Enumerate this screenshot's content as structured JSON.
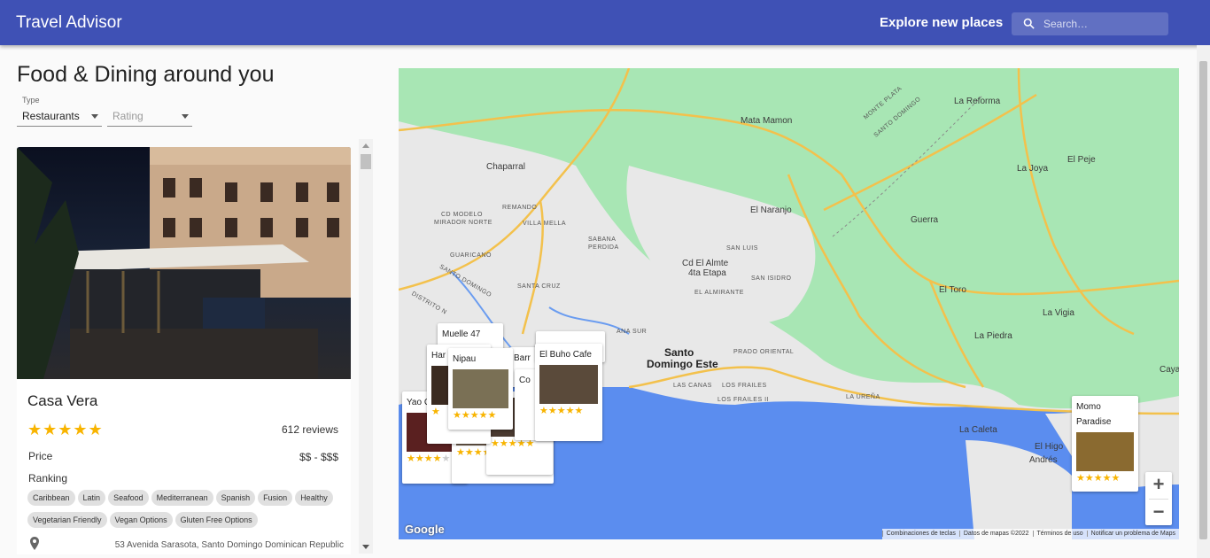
{
  "app": {
    "title": "Travel Advisor",
    "explore_label": "Explore new places",
    "search_placeholder": "Search…"
  },
  "page": {
    "heading": "Food & Dining around you"
  },
  "filters": {
    "type": {
      "label": "Type",
      "value": "Restaurants"
    },
    "rating": {
      "label": "Rating",
      "value": "",
      "placeholder": "Rating"
    }
  },
  "place": {
    "name": "Casa Vera",
    "rating_stars": 5,
    "reviews": "612 reviews",
    "price_label": "Price",
    "price_value": "$$ - $$$",
    "ranking_label": "Ranking",
    "tags": [
      "Caribbean",
      "Latin",
      "Seafood",
      "Mediterranean",
      "Spanish",
      "Fusion",
      "Healthy",
      "Vegetarian Friendly",
      "Vegan Options",
      "Gluten Free Options"
    ],
    "address": "53 Avenida Sarasota, Santo Domingo Dominican Republic"
  },
  "map": {
    "labels": [
      "Mata Mamon",
      "La Reforma",
      "MONTE PLATA",
      "SANTO DOMINGO",
      "Chaparral",
      "La Joya",
      "El Peje",
      "El Naranjo",
      "Guerra",
      "SAN LUIS",
      "Cd El Almte",
      "4ta Etapa",
      "SAN ISIDRO",
      "EL ALMIRANTE",
      "El Toro",
      "La Vigia",
      "La Piedra",
      "Santo",
      "Domingo Este",
      "PRADO ORIENTAL",
      "LAS CANAS",
      "LOS FRAILES",
      "LOS FRAILES II",
      "LA UREÑA",
      "La Caleta",
      "El Higo",
      "Andrés",
      "Caya",
      "CD MODELO",
      "MIRADOR NORTE",
      "REMANDO",
      "VILLA MELLA",
      "SABANA",
      "PERDIDA",
      "GUARICANO",
      "SANTA CRUZ",
      "DISTRITO N",
      "SANTO DOMINGO",
      "ANA SUR"
    ],
    "place_cards": [
      {
        "name": "Muelle 47",
        "stars": 0
      },
      {
        "name": "Har Cafe",
        "stars": 1
      },
      {
        "name": "Nipau",
        "stars": 5
      },
      {
        "name": "Barr",
        "stars": 0
      },
      {
        "name": "Co",
        "stars": 0
      },
      {
        "name": "El Buho Cafe",
        "stars": 5
      },
      {
        "name": "Yao Cuis",
        "stars": 3
      },
      {
        "name": "Momo Paradise",
        "stars": 5
      }
    ],
    "logo": "Google",
    "attribution": [
      "Combinaciones de teclas",
      "Datos de mapas ©2022",
      "Términos de uso",
      "Notificar un problema de Maps"
    ]
  },
  "colors": {
    "appbar": "#3f51b5",
    "star": "#f8b400",
    "land": "#e8e8e8",
    "green": "#a8e6b4",
    "water": "#5b8def",
    "road": "#f3c14c"
  }
}
